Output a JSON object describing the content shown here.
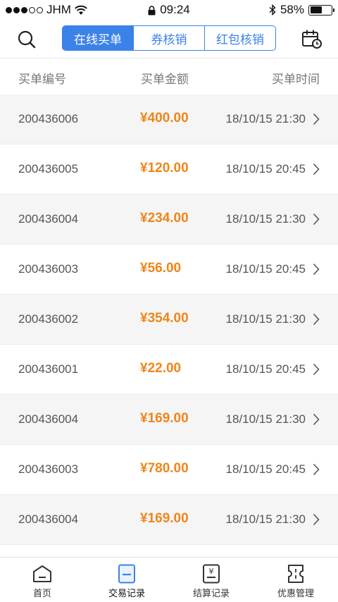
{
  "status_bar": {
    "carrier": "JHM",
    "time": "09:24",
    "battery_percent": "58%",
    "battery_level": 0.58
  },
  "nav": {
    "tabs": [
      {
        "label": "在线买单",
        "active": true
      },
      {
        "label": "券核销",
        "active": false
      },
      {
        "label": "红包核销",
        "active": false
      }
    ]
  },
  "list_header": {
    "id": "买单编号",
    "amount": "买单金额",
    "time": "买单时间"
  },
  "records": [
    {
      "id": "200436006",
      "amount": "¥400.00",
      "time": "18/10/15 21:30"
    },
    {
      "id": "200436005",
      "amount": "¥120.00",
      "time": "18/10/15 20:45"
    },
    {
      "id": "200436004",
      "amount": "¥234.00",
      "time": "18/10/15 21:30"
    },
    {
      "id": "200436003",
      "amount": "¥56.00",
      "time": "18/10/15 20:45"
    },
    {
      "id": "200436002",
      "amount": "¥354.00",
      "time": "18/10/15 21:30"
    },
    {
      "id": "200436001",
      "amount": "¥22.00",
      "time": "18/10/15 20:45"
    },
    {
      "id": "200436004",
      "amount": "¥169.00",
      "time": "18/10/15 21:30"
    },
    {
      "id": "200436003",
      "amount": "¥780.00",
      "time": "18/10/15 20:45"
    },
    {
      "id": "200436004",
      "amount": "¥169.00",
      "time": "18/10/15 21:30"
    }
  ],
  "tab_bar": [
    {
      "label": "首页",
      "icon": "home-icon"
    },
    {
      "label": "交易记录",
      "icon": "transaction-record-icon",
      "active": true
    },
    {
      "label": "结算记录",
      "icon": "settlement-record-icon"
    },
    {
      "label": "优惠管理",
      "icon": "coupon-icon"
    }
  ],
  "colors": {
    "accent_blue": "#3b82e8",
    "amount_orange": "#f08519",
    "row_shade": "#f5f5f5"
  }
}
